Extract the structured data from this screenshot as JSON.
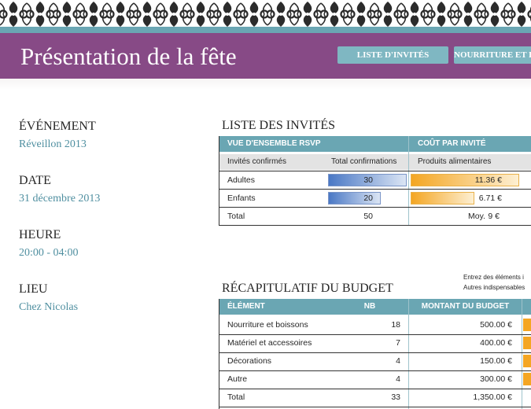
{
  "header": {
    "title": "Présentation de la fête",
    "tabs": [
      "LISTE D'INVITÉS",
      "NOURRITURE ET BOISSONS"
    ],
    "colors": {
      "banner": "#874a86",
      "accent": "#6aa6b3"
    }
  },
  "event": {
    "event_label": "ÉVÉNEMENT",
    "event_value": "Réveillon 2013",
    "date_label": "DATE",
    "date_value": "31 décembre 2013",
    "time_label": "HEURE",
    "time_value": "20:00 - 04:00",
    "place_label": "LIEU",
    "place_value": "Chez Nicolas"
  },
  "guests": {
    "section_title": "LISTE DES INVITÉS",
    "rsvp_header": "VUE D'ENSEMBLE RSVP",
    "cost_header": "COÛT PAR INVITÉ",
    "col_confirmed": "Invités confirmés",
    "col_total": "Total confirmations",
    "col_food": "Produits alimentaires",
    "rows": [
      {
        "label": "Adultes",
        "count": "30",
        "count_fill": 1.0,
        "cost": "11.36 €",
        "cost_fill": 1.0
      },
      {
        "label": "Enfants",
        "count": "20",
        "count_fill": 0.67,
        "cost": "6.71 €",
        "cost_fill": 0.59
      }
    ],
    "total_label": "Total",
    "total_count": "50",
    "avg_label": "Moy.",
    "avg_value": "9 €"
  },
  "budget": {
    "section_title": "RÉCAPITULATIF DU BUDGET",
    "note_line1": "Entrez des éléments i",
    "note_line2": "Autres indispensables",
    "col_item": "ÉLÉMENT",
    "col_qty": "NB",
    "col_amount": "MONTANT DU BUDGET",
    "rows": [
      {
        "item": "Nourriture et boissons",
        "qty": "18",
        "amount": "500.00 €"
      },
      {
        "item": "Matériel et accessoires",
        "qty": "7",
        "amount": "400.00 €"
      },
      {
        "item": "Décorations",
        "qty": "4",
        "amount": "150.00 €"
      },
      {
        "item": "Autre",
        "qty": "4",
        "amount": "300.00 €"
      }
    ],
    "total_label": "Total",
    "total_qty": "33",
    "total_amount": "1,350.00 €"
  }
}
